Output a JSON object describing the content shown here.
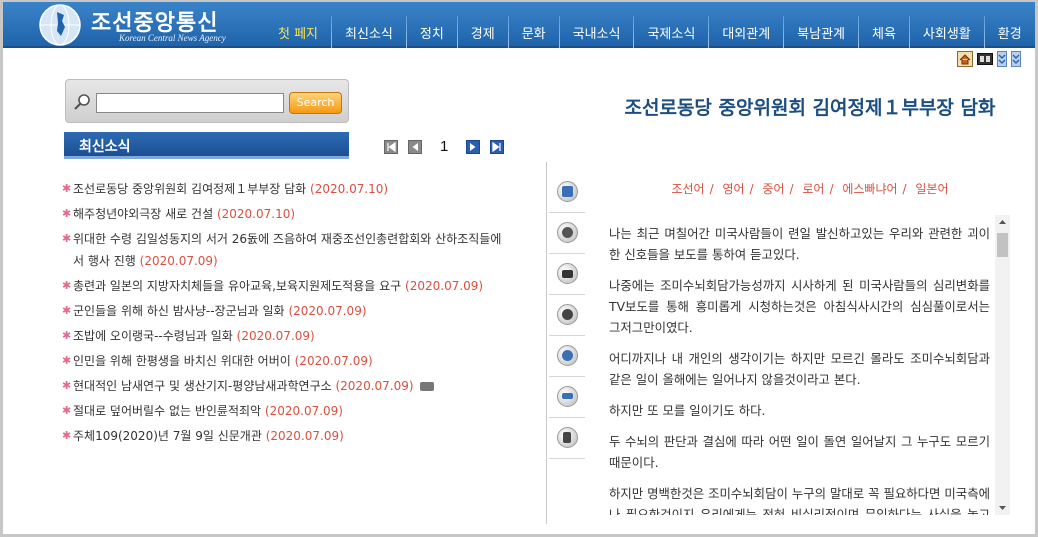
{
  "header": {
    "title": "조선중앙통신",
    "subtitle": "Korean Central News Agency",
    "nav": [
      {
        "label": "첫 페지",
        "active": true
      },
      {
        "label": "최신소식",
        "active": false
      },
      {
        "label": "정치",
        "active": false
      },
      {
        "label": "경제",
        "active": false
      },
      {
        "label": "문화",
        "active": false
      },
      {
        "label": "국내소식",
        "active": false
      },
      {
        "label": "국제소식",
        "active": false
      },
      {
        "label": "대외관계",
        "active": false
      },
      {
        "label": "북남관계",
        "active": false
      },
      {
        "label": "체육",
        "active": false
      },
      {
        "label": "사회생활",
        "active": false
      },
      {
        "label": "환경",
        "active": false
      }
    ]
  },
  "search": {
    "value": "",
    "placeholder": "",
    "button_label": "Search"
  },
  "news": {
    "header_label": "최신소식",
    "page": "1",
    "items": [
      {
        "title": "조선로동당 중앙위원회 김여정제１부부장 담화",
        "date": "(2020.07.10)",
        "camera": false
      },
      {
        "title": "해주청년야외극장 새로 건설",
        "date": "(2020.07.10)",
        "camera": false
      },
      {
        "title": "위대한 수령 김일성동지의 서거 26돐에 즈음하여 재중조선인총련합회와 산하조직들에서 행사 진행",
        "date": "(2020.07.09)",
        "camera": false
      },
      {
        "title": "총련과 일본의 지방자치체들을 유아교육,보육지원제도적용을 요구",
        "date": "(2020.07.09)",
        "camera": false
      },
      {
        "title": "군인들을 위해 하신 밤사냥--장군님과 일화",
        "date": "(2020.07.09)",
        "camera": false
      },
      {
        "title": "조밥에 오이랭국--수령님과 일화",
        "date": "(2020.07.09)",
        "camera": false
      },
      {
        "title": "인민을 위해 한평생을 바치신 위대한 어버이",
        "date": "(2020.07.09)",
        "camera": false
      },
      {
        "title": "현대적인 남새연구 및 생산기지-평양남새과학연구소",
        "date": "(2020.07.09)",
        "camera": true
      },
      {
        "title": "절대로 덮어버릴수 없는 반인륜적죄악",
        "date": "(2020.07.09)",
        "camera": false
      },
      {
        "title": "주체109(2020)년 7월 9일 신문개관",
        "date": "(2020.07.09)",
        "camera": false
      }
    ]
  },
  "side_icons": [
    "text-icon",
    "photo-icon",
    "camera-icon",
    "video-icon",
    "audio-icon",
    "print-icon",
    "speaker-icon"
  ],
  "article": {
    "title": "조선로동당 중앙위원회 김여정제１부부장 담화",
    "languages": [
      "조선어",
      "영어",
      "중어",
      "로어",
      "에스빠냐어",
      "일본어"
    ],
    "paragraphs": [
      "나는 최근 며칠어간 미국사람들이 련일 발신하고있는 우리와 관련한 괴이한 신호들을 보도를 통하여 듣고있다.",
      "나중에는 조미수뇌회담가능성까지 시사하게 된 미국사람들의 심리변화를 TV보도를 통해 흥미롭게 시청하는것은 아침식사시간의 심심풀이로서는 그저그만이였다.",
      "어디까지나 내 개인의 생각이기는 하지만 모르긴 몰라도 조미수뇌회담과 같은 일이 올해에는 일어나지 않을것이라고 본다.",
      "하지만 또 모를 일이기도 하다.",
      "두 수뇌의 판단과 결심에 따라 어떤 일이 돌연 일어날지 그 누구도 모르기때문이다.",
      "하지만 명백한것은 조미수뇌회담이 누구의 말대로 꼭 필요하다면 미국측에나 필요한것이지 우리에게는 전혀 비실리적이며 무익하다는 사실을 놓고 굳건한 시간은 절취놓아야 할것이다."
    ]
  },
  "colors": {
    "header_blue": "#2a72bd",
    "nav_active": "#ffe34a",
    "date_red": "#d9503f",
    "title_blue": "#1c4e82"
  }
}
